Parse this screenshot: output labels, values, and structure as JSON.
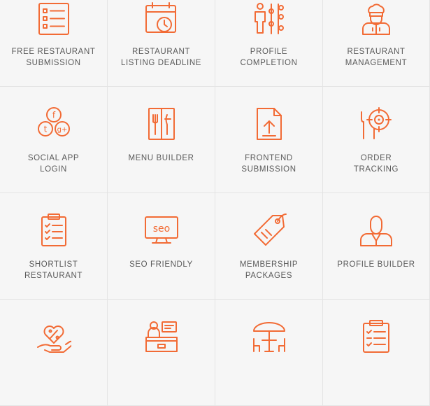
{
  "colors": {
    "accent": "#f26b35",
    "text": "#5a5a5a",
    "cell_bg": "#f6f6f6",
    "border": "#e4e4e4"
  },
  "features": [
    {
      "icon": "list-icon",
      "lines": [
        "FREE RESTAURANT",
        "SUBMISSION"
      ]
    },
    {
      "icon": "calendar-clock-icon",
      "lines": [
        "RESTAURANT",
        "LISTING DEADLINE"
      ]
    },
    {
      "icon": "profile-sliders-icon",
      "lines": [
        "PROFILE",
        "COMPLETION"
      ]
    },
    {
      "icon": "chef-icon",
      "lines": [
        "RESTAURANT",
        "MANAGEMENT"
      ]
    },
    {
      "icon": "social-circles-icon",
      "lines": [
        "SOCIAL APP",
        "LOGIN"
      ]
    },
    {
      "icon": "menu-book-icon",
      "lines": [
        "MENU BUILDER"
      ]
    },
    {
      "icon": "upload-document-icon",
      "lines": [
        "FRONTEND",
        "SUBMISSION"
      ]
    },
    {
      "icon": "order-tracking-icon",
      "lines": [
        "ORDER",
        "TRACKING"
      ]
    },
    {
      "icon": "clipboard-checklist-icon",
      "lines": [
        "SHORTLIST",
        "RESTAURANT"
      ]
    },
    {
      "icon": "seo-monitor-icon",
      "lines": [
        "SEO FRIENDLY"
      ]
    },
    {
      "icon": "tag-icon",
      "lines": [
        "MEMBERSHIP",
        "PACKAGES"
      ]
    },
    {
      "icon": "user-profile-icon",
      "lines": [
        "PROFILE BUILDER"
      ]
    },
    {
      "icon": "heart-percent-hand-icon",
      "lines": []
    },
    {
      "icon": "reception-desk-icon",
      "lines": []
    },
    {
      "icon": "umbrella-table-icon",
      "lines": []
    },
    {
      "icon": "clipboard-list-icon",
      "lines": []
    }
  ],
  "social_glyphs": {
    "facebook": "f",
    "twitter": "t",
    "googleplus": "g+"
  },
  "seo_text": "seo"
}
